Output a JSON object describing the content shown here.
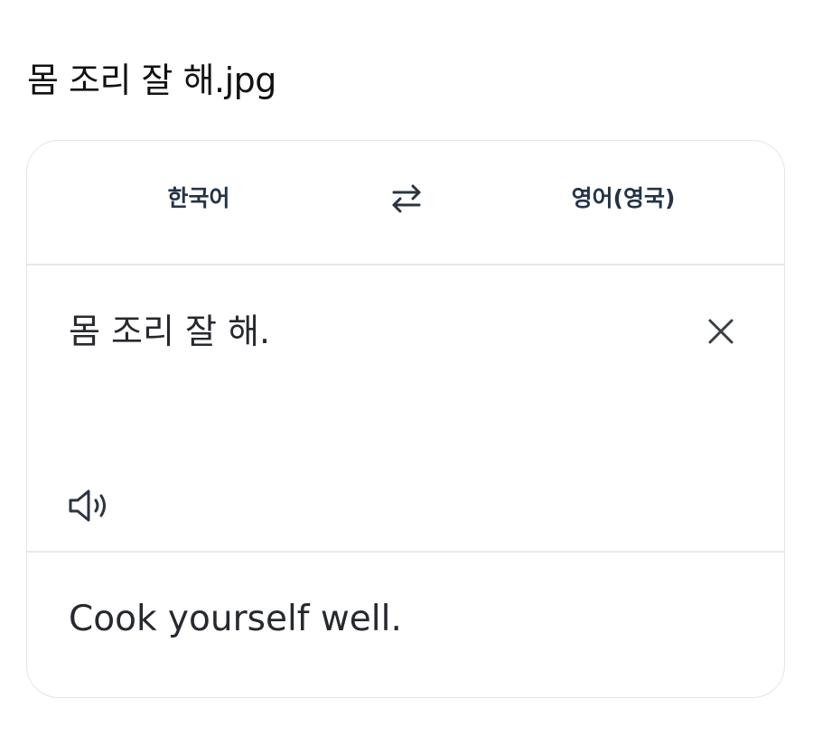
{
  "post": {
    "title": "몸 조리 잘 해.jpg"
  },
  "translator": {
    "source_language": "한국어",
    "target_language": "영어(영국)",
    "source_text": "몸 조리 잘 해.",
    "translated_text": "Cook yourself well.",
    "icons": {
      "swap": "swap-arrows-icon",
      "clear": "close-icon",
      "speak": "speaker-icon"
    }
  },
  "colors": {
    "background": "#ffffff",
    "card_border": "#e3e5e8",
    "language_label": "#243447",
    "body_text": "#26292e",
    "icon": "#2b3440"
  }
}
